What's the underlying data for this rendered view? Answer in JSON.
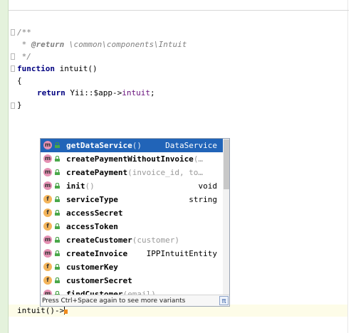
{
  "editor": {
    "lines": {
      "doc_open": "/**",
      "doc_return_prefix": " * ",
      "doc_return_tag": "@return",
      "doc_return_type": " \\common\\components\\Intuit",
      "doc_close": " */",
      "fn_keyword": "function",
      "fn_name": " intuit()",
      "open_brace": "{",
      "return_keyword": "return",
      "return_expr": " Yii::$app->",
      "return_prop": "intuit",
      "return_end": ";",
      "close_brace": "}",
      "typing_text": "intuit()->"
    }
  },
  "autocomplete": {
    "items": [
      {
        "kind": "m",
        "name": "getDataService",
        "params": "()",
        "type": "DataService",
        "selected": true
      },
      {
        "kind": "m",
        "name": "createPaymentWithoutInvoice",
        "params": "(…",
        "type": "",
        "selected": false
      },
      {
        "kind": "m",
        "name": "createPayment",
        "params": "(invoice_id, to…",
        "type": "",
        "selected": false
      },
      {
        "kind": "m",
        "name": "init",
        "params": "()",
        "type": "void",
        "selected": false
      },
      {
        "kind": "f",
        "name": "serviceType",
        "params": "",
        "type": "string",
        "selected": false
      },
      {
        "kind": "f",
        "name": "accessSecret",
        "params": "",
        "type": "",
        "selected": false
      },
      {
        "kind": "f",
        "name": "accessToken",
        "params": "",
        "type": "",
        "selected": false
      },
      {
        "kind": "m",
        "name": "createCustomer",
        "params": "(customer)",
        "type": "",
        "selected": false
      },
      {
        "kind": "m",
        "name": "createInvoice",
        "params": "",
        "type": "IPPIntuitEntity",
        "selected": false
      },
      {
        "kind": "f",
        "name": "customerKey",
        "params": "",
        "type": "",
        "selected": false
      },
      {
        "kind": "f",
        "name": "customerSecret",
        "params": "",
        "type": "",
        "selected": false
      },
      {
        "kind": "m",
        "name": "findCustomer",
        "params": "(email)",
        "type": "",
        "selected": false
      }
    ],
    "footer_hint": "Press Ctrl+Space again to see more variants",
    "pi_symbol": "π",
    "colors": {
      "selection": "#2164b8",
      "method_badge": "#e591b4",
      "field_badge": "#f3b45b"
    }
  }
}
